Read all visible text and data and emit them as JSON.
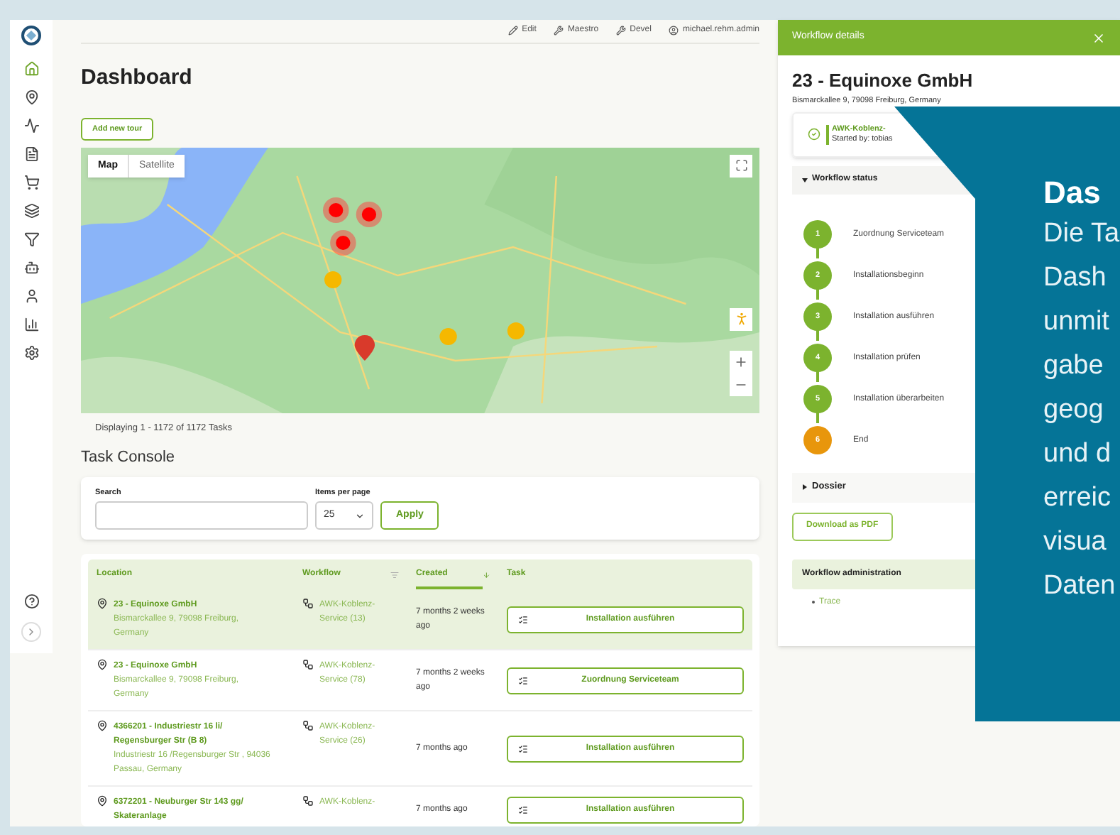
{
  "sidebar": {
    "items": [
      {
        "selected": true
      },
      {
        "selected": false
      },
      {
        "selected": false
      },
      {
        "selected": false
      },
      {
        "selected": false
      },
      {
        "selected": false
      },
      {
        "selected": false
      },
      {
        "selected": false
      },
      {
        "selected": false
      },
      {
        "selected": false
      },
      {
        "selected": false
      }
    ]
  },
  "topbar": [
    "Edit",
    "Maestro",
    "Devel",
    "michael.rehm.admin"
  ],
  "title": "Dashboard",
  "add_button": "Add new tour",
  "map": {
    "tabs": [
      {
        "label": "Map",
        "selected": true
      },
      {
        "label": "Satellite",
        "selected": false
      }
    ]
  },
  "displaying": "Displaying 1 - 1172 of 1172 Tasks",
  "console": {
    "title": "Task Console",
    "search_label": "Search",
    "items_label": "Items per page",
    "items_value": "25",
    "apply": "Apply"
  },
  "table": {
    "columns": [
      {
        "label": "Location",
        "selected": false
      },
      {
        "label": "Workflow",
        "selected": false
      },
      {
        "label": "Created",
        "selected": true
      },
      {
        "label": "Task",
        "selected": false
      }
    ],
    "rows": [
      {
        "selected": true,
        "name": "23 - Equinoxe GmbH",
        "address": "Bismarckallee 9, 79098 Freiburg, Germany",
        "workflow": "AWK-Koblenz-Service (13)",
        "created": "7 months 2 weeks ago",
        "task": "Installation ausführen"
      },
      {
        "selected": false,
        "name": "23 - Equinoxe GmbH",
        "address": "Bismarckallee 9, 79098 Freiburg, Germany",
        "workflow": "AWK-Koblenz-Service (78)",
        "created": "7 months 2 weeks ago",
        "task": "Zuordnung Serviceteam"
      },
      {
        "selected": false,
        "name": "4366201 - Industriestr 16 li/ Regensburger Str (B 8)",
        "address": "Industriestr 16 /Regensburger Str , 94036 Passau, Germany",
        "workflow": "AWK-Koblenz-Service (26)",
        "created": "7 months ago",
        "task": "Installation ausführen"
      },
      {
        "selected": false,
        "name": "6372201 - Neuburger Str 143 gg/ Skateranlage",
        "workflow": "AWK-Koblenz-",
        "created": "7 months ago",
        "task": "Installation ausführen"
      }
    ]
  },
  "workflow_panel": {
    "header": "Workflow details",
    "title": "23 - Equinoxe GmbH",
    "address": "Bismarckallee 9, 79098 Freiburg, Germany",
    "workflow_name": "AWK-Koblenz-",
    "started_by": "Started by: tobias",
    "status_title": "Workflow status",
    "expanded": true,
    "steps": [
      {
        "number": "1",
        "label": "Zuordnung Serviceteam",
        "selected": false
      },
      {
        "number": "2",
        "label": "Installationsbeginn",
        "selected": false
      },
      {
        "number": "3",
        "label": "Installation ausführen",
        "selected": false
      },
      {
        "number": "4",
        "label": "Installation prüfen",
        "selected": false
      },
      {
        "number": "5",
        "label": "Installation überarbeiten",
        "selected": false
      },
      {
        "number": "6",
        "label": "End",
        "selected": true
      }
    ],
    "dossier": "Dossier",
    "dossier_expanded": false,
    "download": "Download as PDF",
    "admin_title": "Workflow administration",
    "admin_links": [
      "Trace"
    ]
  },
  "overlay": {
    "title": "Das",
    "lines": [
      "Die Ta",
      "Dash",
      "unmit",
      "gabe",
      "geog",
      "und d",
      "erreic",
      "visua",
      "Daten"
    ]
  }
}
